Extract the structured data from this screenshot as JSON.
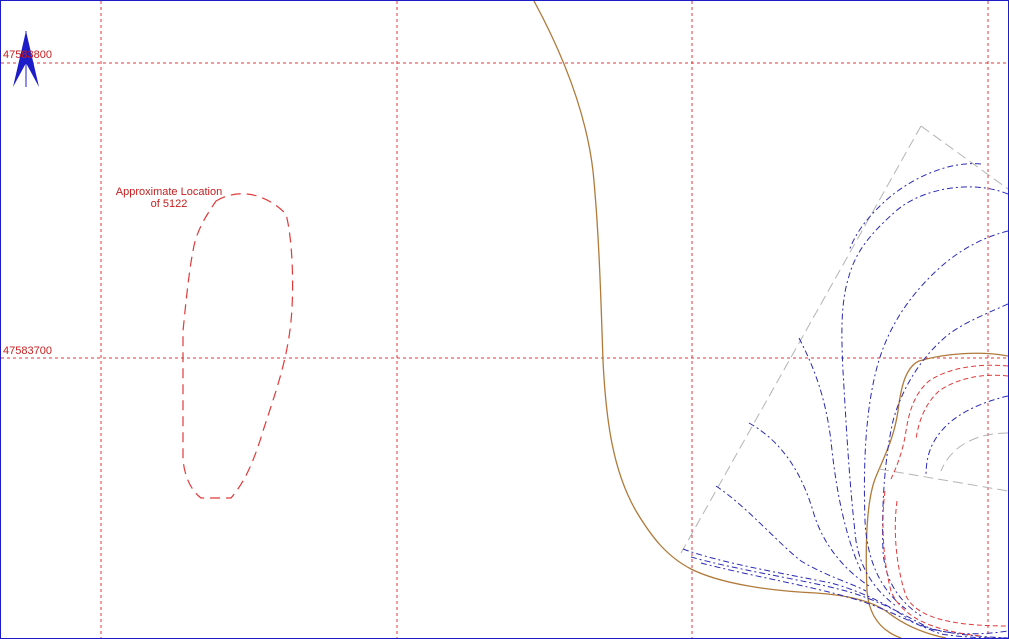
{
  "map": {
    "grid_labels": {
      "northing_top": "47583800",
      "northing_mid": "47583700"
    },
    "annotation": {
      "line1": "Approximate Location",
      "line2": "of 5122"
    },
    "colors": {
      "grid": "#e03a3a",
      "label": "#c81e1e",
      "boundary": "#e03a3a",
      "river": "#b07a3a",
      "contour": "#2a2ab4",
      "parcel": "#b4b4b4",
      "north_arrow": "#1c1cc8",
      "frame": "#1c1cc8"
    },
    "north_arrow": {
      "icon": "north-arrow-icon"
    }
  }
}
